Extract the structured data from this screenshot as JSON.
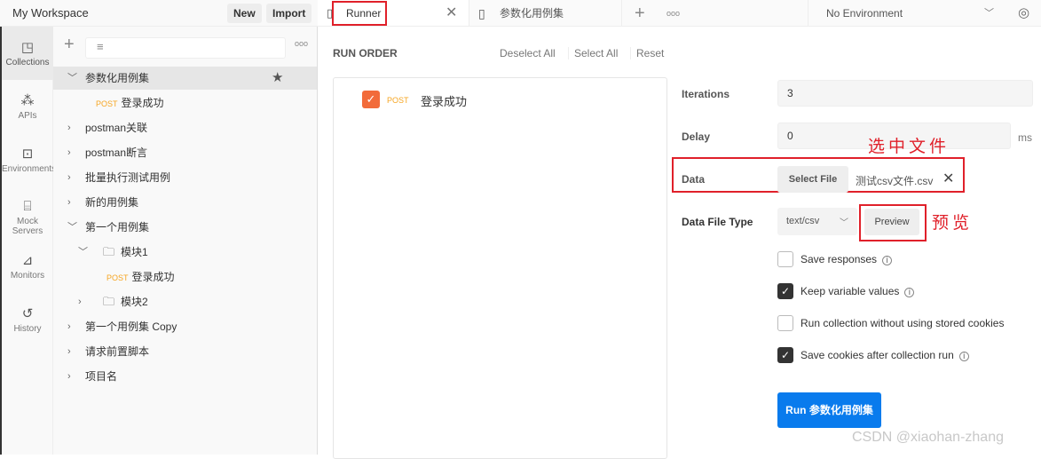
{
  "workspace": {
    "title": "My Workspace",
    "new_label": "New",
    "import_label": "Import"
  },
  "iconbar": [
    {
      "label": "Collections",
      "icon": "collections-icon",
      "glyph": "◳"
    },
    {
      "label": "APIs",
      "icon": "apis-icon",
      "glyph": "⁂"
    },
    {
      "label": "Environments",
      "icon": "environments-icon",
      "glyph": "⊡"
    },
    {
      "label": "Mock Servers",
      "icon": "mock-servers-icon",
      "glyph": "⌸"
    },
    {
      "label": "Monitors",
      "icon": "monitors-icon",
      "glyph": "⊿"
    },
    {
      "label": "History",
      "icon": "history-icon",
      "glyph": "↺"
    }
  ],
  "sidebar": {
    "items": [
      {
        "label": "参数化用例集",
        "expanded": true,
        "starred": true
      },
      {
        "label": "登录成功",
        "method": "POST"
      },
      {
        "label": "postman关联"
      },
      {
        "label": "postman断言"
      },
      {
        "label": "批量执行测试用例"
      },
      {
        "label": "新的用例集"
      },
      {
        "label": "第一个用例集",
        "expanded": true
      },
      {
        "label": "模块1",
        "folder": true,
        "expanded": true
      },
      {
        "label": "登录成功",
        "method": "POST"
      },
      {
        "label": "模块2",
        "folder": true
      },
      {
        "label": "第一个用例集 Copy"
      },
      {
        "label": "请求前置脚本"
      },
      {
        "label": "项目名"
      }
    ]
  },
  "tabs": [
    {
      "label": "Runner"
    },
    {
      "label": "参数化用例集"
    }
  ],
  "environment": {
    "selected": "No Environment"
  },
  "run_order": {
    "title": "RUN ORDER",
    "deselect_all": "Deselect All",
    "select_all": "Select All",
    "reset": "Reset",
    "items": [
      {
        "method": "POST",
        "label": "登录成功",
        "checked": true
      }
    ]
  },
  "settings": {
    "iterations_label": "Iterations",
    "iterations": "3",
    "delay_label": "Delay",
    "delay": "0",
    "delay_unit": "ms",
    "data_label": "Data",
    "select_file": "Select File",
    "file_name": "测试csv文件.csv",
    "file_type_label": "Data File Type",
    "file_type": "text/csv",
    "preview": "Preview",
    "options": [
      {
        "label": "Save responses",
        "checked": false,
        "info": true
      },
      {
        "label": "Keep variable values",
        "checked": true,
        "info": true
      },
      {
        "label": "Run collection without using stored cookies",
        "checked": false,
        "info": false
      },
      {
        "label": "Save cookies after collection run",
        "checked": true,
        "info": true
      }
    ],
    "run_button": "Run 参数化用例集"
  },
  "annotations": {
    "select_file_note": "选中文件",
    "preview_note": "预览"
  },
  "watermark": "CSDN @xiaohan-zhang",
  "colors": {
    "accent": "#f26b3a",
    "run_button": "#097bed",
    "annotation": "#e0202a",
    "post": "#f6a623"
  }
}
